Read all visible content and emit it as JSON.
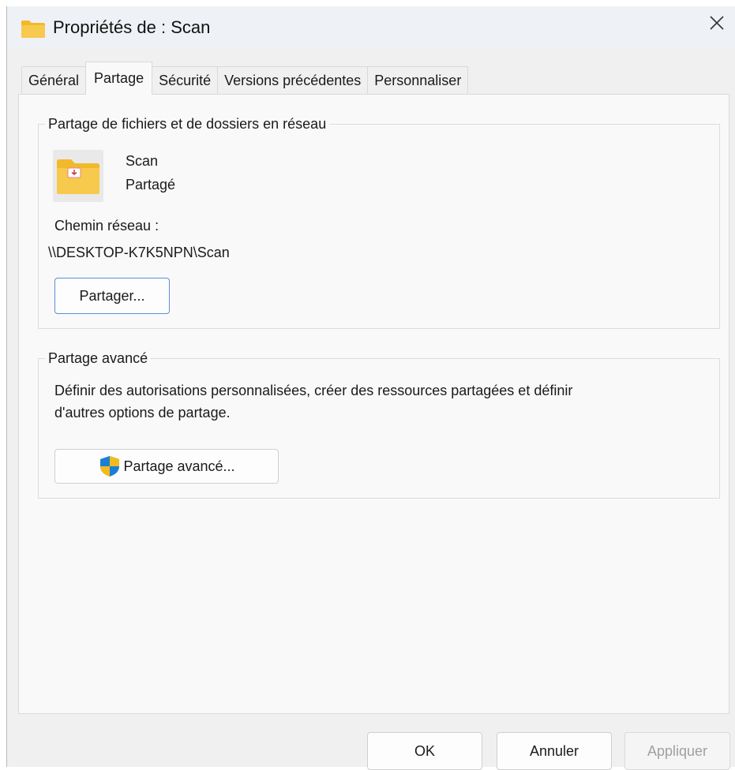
{
  "window": {
    "title": "Propriétés de : Scan"
  },
  "tabs": [
    {
      "label": "Général",
      "active": false
    },
    {
      "label": "Partage",
      "active": true
    },
    {
      "label": "Sécurité",
      "active": false
    },
    {
      "label": "Versions précédentes",
      "active": false
    },
    {
      "label": "Personnaliser",
      "active": false
    }
  ],
  "network_sharing": {
    "legend": "Partage de fichiers et de dossiers en réseau",
    "folder_name": "Scan",
    "share_status": "Partagé",
    "network_path_label": "Chemin réseau :",
    "network_path": "\\\\DESKTOP-K7K5NPN\\Scan",
    "share_button_label": "Partager..."
  },
  "advanced_sharing": {
    "legend": "Partage avancé",
    "description_line1": "Définir des autorisations personnalisées, créer des ressources partagées et définir",
    "description_line2": "d'autres options de partage.",
    "button_label": "Partage avancé..."
  },
  "footer": {
    "ok_label": "OK",
    "cancel_label": "Annuler",
    "apply_label": "Appliquer"
  },
  "icons": {
    "title": "folder-icon",
    "close": "close-icon",
    "shared_folder": "shared-folder-icon",
    "uac_shield": "uac-shield-icon"
  },
  "colors": {
    "folder_yellow": "#f7c94d",
    "focus_blue": "#5a8fd8",
    "shield_blue": "#1c7fd6",
    "shield_yellow": "#f3bb1c"
  }
}
